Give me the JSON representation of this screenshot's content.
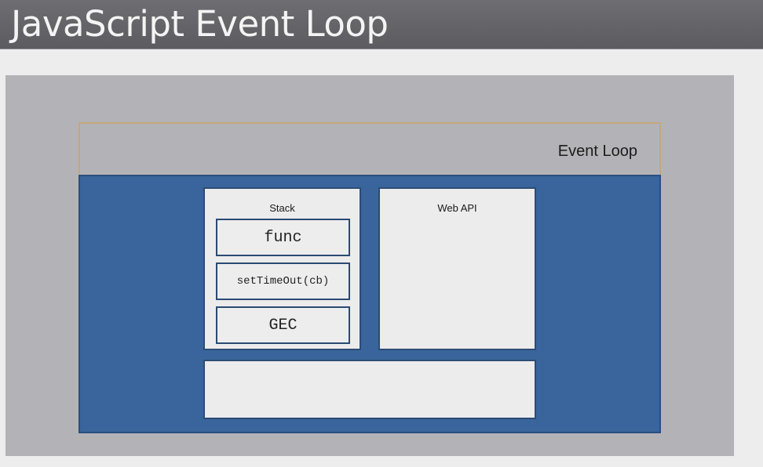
{
  "slide": {
    "title": "JavaScript Event Loop"
  },
  "diagram": {
    "event_loop_label": "Event Loop",
    "stack": {
      "label": "Stack",
      "frames": [
        "func",
        "setTimeOut(cb)",
        "GEC"
      ]
    },
    "web_api": {
      "label": "Web API"
    },
    "callback_queue": {
      "label": ""
    }
  },
  "colors": {
    "title_bar": "#646468",
    "outer_panel": "#b3b3b7",
    "runtime_area": "#39659c",
    "event_loop_border": "#c2a87d",
    "box_fill": "#ececed",
    "box_border": "#2d4c74"
  }
}
